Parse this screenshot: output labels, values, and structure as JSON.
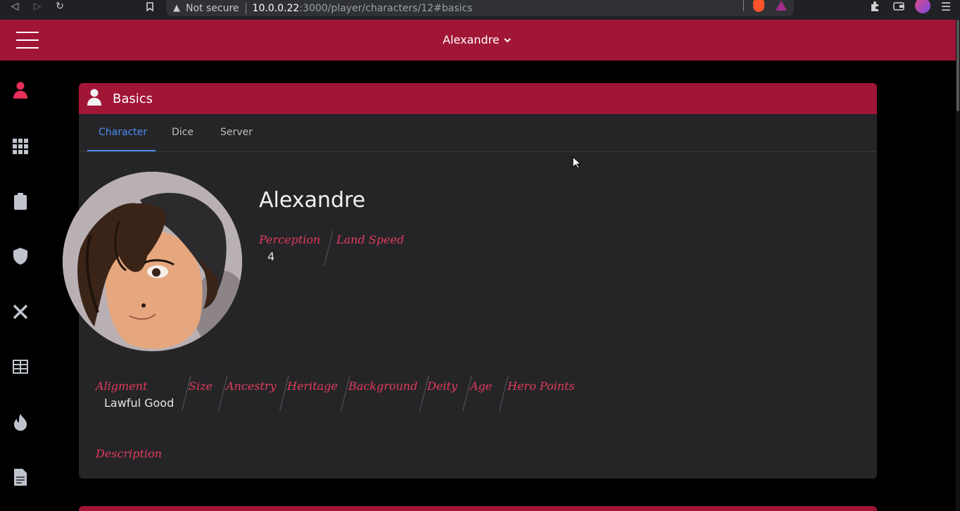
{
  "browser": {
    "security_label": "Not secure",
    "url_host": "10.0.0.22",
    "url_path": ":3000/player/characters/12#basics"
  },
  "appbar": {
    "character_name": "Alexandre"
  },
  "card": {
    "title": "Basics",
    "tabs": [
      {
        "label": "Character",
        "active": true
      },
      {
        "label": "Dice",
        "active": false
      },
      {
        "label": "Server",
        "active": false
      }
    ]
  },
  "character": {
    "name": "Alexandre",
    "perception_label": "Perception",
    "perception_value": "4",
    "land_speed_label": "Land Speed",
    "land_speed_value": "",
    "alignment_label": "Aligment",
    "alignment_value": "Lawful Good",
    "size_label": "Size",
    "ancestry_label": "Ancestry",
    "heritage_label": "Heritage",
    "background_label": "Background",
    "deity_label": "Deity",
    "age_label": "Age",
    "hero_points_label": "Hero Points",
    "description_label": "Description"
  },
  "colors": {
    "brand": "#a11537",
    "label_accent": "#e23b5c",
    "tab_active": "#4a8ef0",
    "card_bg": "#252528"
  },
  "icons": {
    "rail": [
      "person-icon",
      "apps-grid-icon",
      "clipboard-icon",
      "shield-icon",
      "crossed-swords-icon",
      "table-icon",
      "flame-icon",
      "document-icon"
    ]
  }
}
